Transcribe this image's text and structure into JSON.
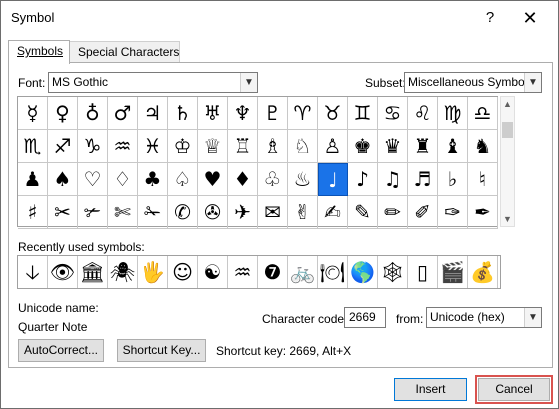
{
  "window": {
    "title": "Symbol",
    "help_glyph": "?",
    "close_glyph": "✕"
  },
  "tabs": [
    {
      "label": "Symbols",
      "active": true
    },
    {
      "label": "Special Characters",
      "active": false
    }
  ],
  "font": {
    "label": "Font:",
    "value": "MS Gothic"
  },
  "subset": {
    "label": "Subset:",
    "value": "Miscellaneous Symbols"
  },
  "symbol_grid": {
    "rows": [
      [
        "☿",
        "♀",
        "♁",
        "♂",
        "♃",
        "♄",
        "♅",
        "♆",
        "♇",
        "♈",
        "♉",
        "♊",
        "♋",
        "♌",
        "♍",
        "♎"
      ],
      [
        "♏",
        "♐",
        "♑",
        "♒",
        "♓",
        "♔",
        "♕",
        "♖",
        "♗",
        "♘",
        "♙",
        "♚",
        "♛",
        "♜",
        "♝",
        "♞"
      ],
      [
        "♟",
        "♠",
        "♡",
        "♢",
        "♣",
        "♤",
        "♥",
        "♦",
        "♧",
        "♨",
        "♩",
        "♪",
        "♫",
        "♬",
        "♭",
        "♮"
      ],
      [
        "♯",
        "✂",
        "✃",
        "✄",
        "✁",
        "✆",
        "✇",
        "✈",
        "✉",
        "✌",
        "✍",
        "✎",
        "✏",
        "✐",
        "✑",
        "✒"
      ]
    ],
    "selected": {
      "row": 2,
      "col": 10
    }
  },
  "recent": {
    "label": "Recently used symbols:",
    "items": [
      "🡣",
      "👁",
      "🏛",
      "🕷",
      "🖐",
      "☺",
      "☯",
      "♒",
      "❼",
      "🚲",
      "🍽",
      "🌎",
      "🕸",
      "▯",
      "🎬",
      "💰"
    ]
  },
  "unicode_name": {
    "label": "Unicode name:",
    "value": "Quarter Note"
  },
  "character_code": {
    "label": "Character code:",
    "value": "2669"
  },
  "from": {
    "label": "from:",
    "value": "Unicode (hex)"
  },
  "buttons": {
    "autocorrect": "AutoCorrect...",
    "shortcut_key": "Shortcut Key...",
    "insert": "Insert",
    "cancel": "Cancel"
  },
  "shortcut_info": "Shortcut key: 2669, Alt+X",
  "colors": {
    "selection": "#1a73e8",
    "cancel_highlight": "#d9534f",
    "primary_border": "#0078d7"
  }
}
